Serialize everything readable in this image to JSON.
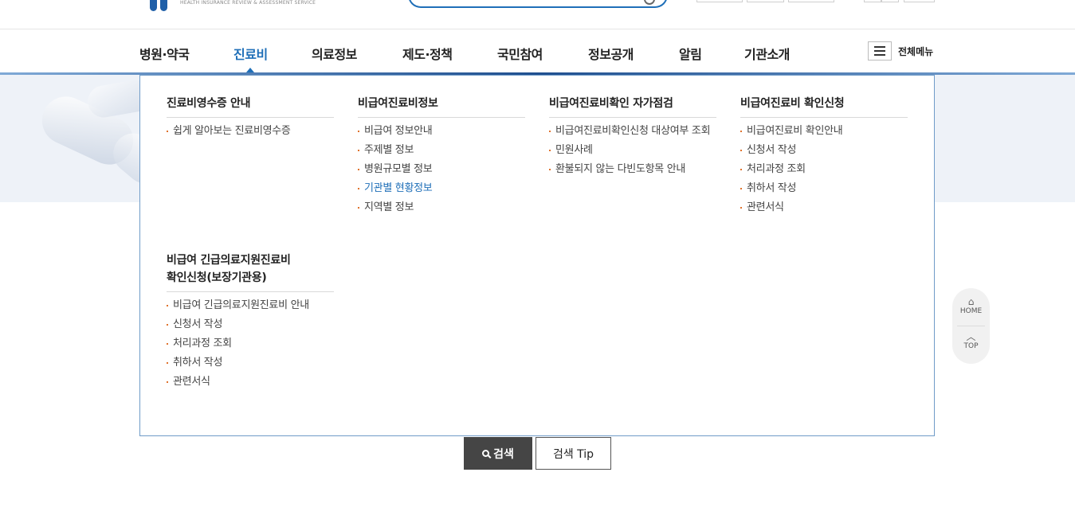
{
  "header": {
    "org_name_en": "HEALTH INSURANCE REVIEW & ASSESSMENT SERVICE"
  },
  "gnb": {
    "items": [
      {
        "label": "병원·약국"
      },
      {
        "label": "진료비"
      },
      {
        "label": "의료정보"
      },
      {
        "label": "제도·정책"
      },
      {
        "label": "국민참여"
      },
      {
        "label": "정보공개"
      },
      {
        "label": "알림"
      },
      {
        "label": "기관소개"
      }
    ],
    "active_index": 1,
    "all_menu_label": "전체메뉴"
  },
  "dropdown": {
    "columns": [
      {
        "title": "진료비영수증 안내",
        "items": [
          "쉽게 알아보는 진료비영수증"
        ]
      },
      {
        "title": "비급여진료비정보",
        "items": [
          "비급여 정보안내",
          "주제별 정보",
          "병원규모별 정보",
          "기관별 현황정보",
          "지역별 정보"
        ],
        "active_item": "기관별 현황정보"
      },
      {
        "title": "비급여진료비확인 자가점검",
        "items": [
          "비급여진료비확인신청 대상여부 조회",
          "민원사례",
          "환불되지 않는 다빈도항목 안내"
        ]
      },
      {
        "title": "비급여진료비 확인신청",
        "items": [
          "비급여진료비 확인안내",
          "신청서 작성",
          "처리과정 조회",
          "취하서 작성",
          "관련서식"
        ]
      },
      {
        "title_line1": "비급여 긴급의료지원진료비",
        "title_line2": "확인신청(보장기관용)",
        "items": [
          "비급여 긴급의료지원진료비 안내",
          "신청서 작성",
          "처리과정 조회",
          "취하서 작성",
          "관련서식"
        ]
      }
    ]
  },
  "search": {
    "search_label": "검색",
    "tip_label": "검색 Tip"
  },
  "quick": {
    "home_label": "HOME",
    "top_label": "TOP"
  },
  "colors": {
    "accent": "#1f6fb8",
    "bullet": "#e0732d",
    "panel_border": "#6f9bc8"
  }
}
